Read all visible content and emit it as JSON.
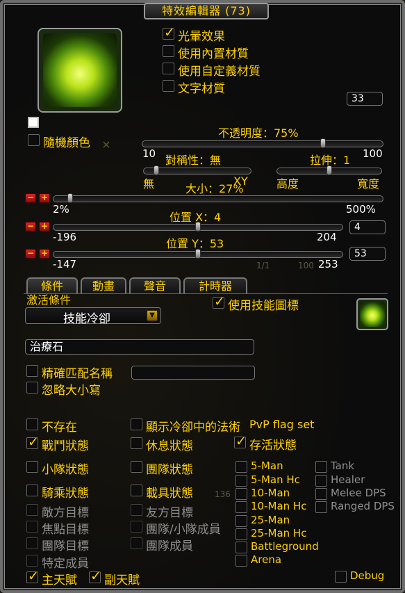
{
  "window": {
    "title": "特效編輯器 (73)"
  },
  "colors": {
    "accent": "#ffd100",
    "value_text": "#ffffff",
    "disabled_text": "#8f8f8f",
    "minus_plus_red": "#d22222"
  },
  "top_checks": [
    {
      "label": "光暈效果",
      "checked": true
    },
    {
      "label": "使用內置材質",
      "checked": false
    },
    {
      "label": "使用自定義材質",
      "checked": false
    },
    {
      "label": "文字材質",
      "checked": false
    }
  ],
  "count_box": "33",
  "random_color": {
    "label": "隨機顏色",
    "checked": false
  },
  "opacity": {
    "label": "不透明度：75%",
    "min": "10",
    "max": "100",
    "value": 0.75
  },
  "symmetry": {
    "label": "對稱性：無",
    "left": "無",
    "right": "XY",
    "value": 0.12
  },
  "stretch": {
    "label": "拉伸：1",
    "left": "高度",
    "right": "寬度",
    "value": 0.5
  },
  "size": {
    "label": "大小：27%",
    "min": "2%",
    "max": "500%",
    "value": 0.05
  },
  "pos_x": {
    "label": "位置 X：4",
    "min": "-196",
    "max": "204",
    "box": "4",
    "value": 0.5
  },
  "pos_y": {
    "label": "位置 Y：53",
    "min": "-147",
    "max": "253",
    "box": "53",
    "value": 0.5
  },
  "tabs": [
    {
      "label": "條件",
      "active": true
    },
    {
      "label": "動畫",
      "active": false
    },
    {
      "label": "聲音",
      "active": false
    },
    {
      "label": "計時器",
      "active": false
    }
  ],
  "activation": {
    "label": "激活條件",
    "dropdown_value": "技能冷卻",
    "use_skill_icon": {
      "label": "使用技能圖標",
      "checked": true
    }
  },
  "spell_name": "治療石",
  "exact_match": {
    "label": "精確匹配名稱",
    "checked": false
  },
  "ignore_case": {
    "label": "忽略大小寫",
    "checked": false
  },
  "col1": [
    {
      "label": "不存在",
      "checked": false,
      "enabled": true
    },
    {
      "label": "戰鬥狀態",
      "checked": true,
      "enabled": true
    },
    {
      "label": "小隊狀態",
      "checked": false,
      "enabled": true
    },
    {
      "label": "騎乘狀態",
      "checked": false,
      "enabled": true
    },
    {
      "label": "敵方目標",
      "checked": false,
      "enabled": false
    },
    {
      "label": "焦點目標",
      "checked": false,
      "enabled": false
    },
    {
      "label": "團隊目標",
      "checked": false,
      "enabled": false
    },
    {
      "label": "特定成員",
      "checked": false,
      "enabled": false
    },
    {
      "label": "主天賦",
      "checked": true,
      "enabled": true
    }
  ],
  "col2": [
    {
      "label": "顯示冷卻中的法術",
      "checked": false,
      "enabled": true
    },
    {
      "label": "休息狀態",
      "checked": false,
      "enabled": true
    },
    {
      "label": "團隊狀態",
      "checked": false,
      "enabled": true
    },
    {
      "label": "載具狀態",
      "checked": false,
      "enabled": true
    },
    {
      "label": "友方目標",
      "checked": false,
      "enabled": false
    },
    {
      "label": "團隊/小隊成員",
      "checked": false,
      "enabled": false
    },
    {
      "label": "團隊成員",
      "checked": false,
      "enabled": false
    },
    {
      "label": "副天賦",
      "checked": true,
      "enabled": true
    }
  ],
  "pvp_flag": {
    "label": "PvP flag set"
  },
  "alive": {
    "label": "存活狀態",
    "checked": true
  },
  "instance_types": [
    {
      "label": "5-Man",
      "checked": false
    },
    {
      "label": "5-Man Hc",
      "checked": false
    },
    {
      "label": "10-Man",
      "checked": false
    },
    {
      "label": "10-Man Hc",
      "checked": false
    },
    {
      "label": "25-Man",
      "checked": false
    },
    {
      "label": "25-Man Hc",
      "checked": false
    },
    {
      "label": "Battleground",
      "checked": false
    },
    {
      "label": "Arena",
      "checked": false
    }
  ],
  "roles": [
    {
      "label": "Tank",
      "checked": false
    },
    {
      "label": "Healer",
      "checked": false
    },
    {
      "label": "Melee DPS",
      "checked": false
    },
    {
      "label": "Ranged DPS",
      "checked": false
    }
  ],
  "debug": {
    "label": "Debug",
    "checked": false
  },
  "bg_numbers": {
    "a": "1/1",
    "b": "100",
    "c": "136"
  }
}
